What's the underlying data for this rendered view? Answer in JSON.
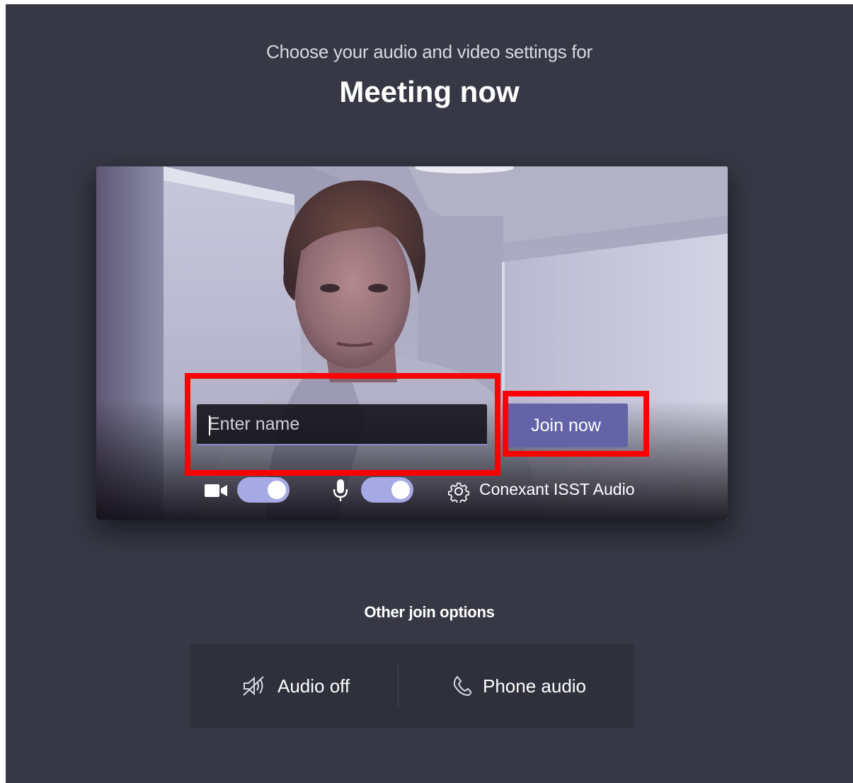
{
  "header": {
    "subtitle": "Choose your audio and video settings for",
    "title": "Meeting now"
  },
  "join": {
    "name_placeholder": "Enter name",
    "name_value": "",
    "join_label": "Join now"
  },
  "devices": {
    "camera_on": true,
    "mic_on": true,
    "audio_device": "Conexant ISST Audio"
  },
  "other_options": {
    "title": "Other join options",
    "items": [
      {
        "label": "Audio off",
        "icon": "speaker-off-icon"
      },
      {
        "label": "Phone audio",
        "icon": "phone-icon"
      }
    ]
  },
  "colors": {
    "background": "#373745",
    "accent": "#6264a7",
    "toggle_on": "#a7a9e5",
    "highlight": "#ff0000"
  }
}
